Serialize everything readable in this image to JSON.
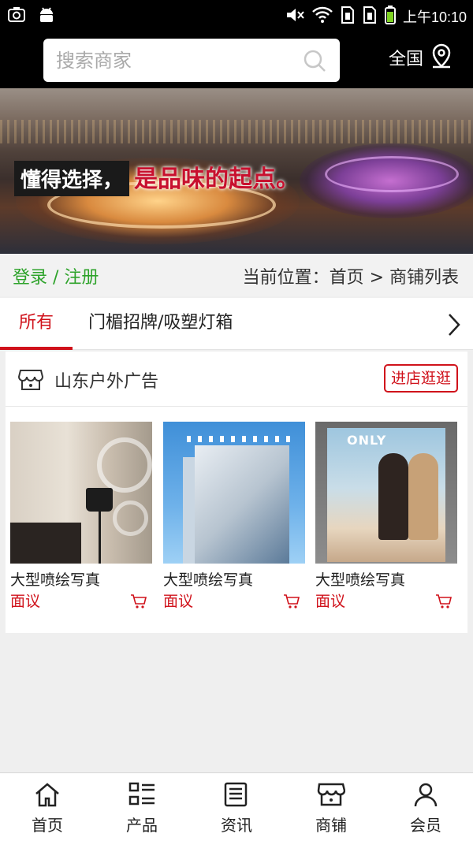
{
  "status_bar": {
    "time": "上午10:10"
  },
  "search": {
    "placeholder": "搜索商家",
    "region_label": "全国"
  },
  "banner": {
    "slogan_left": "懂得选择，",
    "slogan_right": "是品味的起点。"
  },
  "location_bar": {
    "login_link": "登录 / 注册",
    "breadcrumb": "当前位置：首页 > 商铺列表"
  },
  "tabs": [
    {
      "label": "所有",
      "active": true
    },
    {
      "label": "门楣招牌/吸塑灯箱",
      "active": false
    }
  ],
  "shop": {
    "name": "山东户外广告",
    "enter_label": "进店逛逛",
    "products": [
      {
        "title": "大型喷绘写真",
        "price": "面议"
      },
      {
        "title": "大型喷绘写真",
        "price": "面议"
      },
      {
        "title": "大型喷绘写真",
        "price": "面议",
        "image_text": "ONLY"
      }
    ]
  },
  "bottom_nav": [
    {
      "label": "首页",
      "icon": "home-icon"
    },
    {
      "label": "产品",
      "icon": "grid-list-icon"
    },
    {
      "label": "资讯",
      "icon": "news-icon"
    },
    {
      "label": "商铺",
      "icon": "store-icon"
    },
    {
      "label": "会员",
      "icon": "user-icon"
    }
  ],
  "colors": {
    "accent": "#d0121b",
    "login_green": "#2ea32b",
    "header_bg": "#000000"
  }
}
